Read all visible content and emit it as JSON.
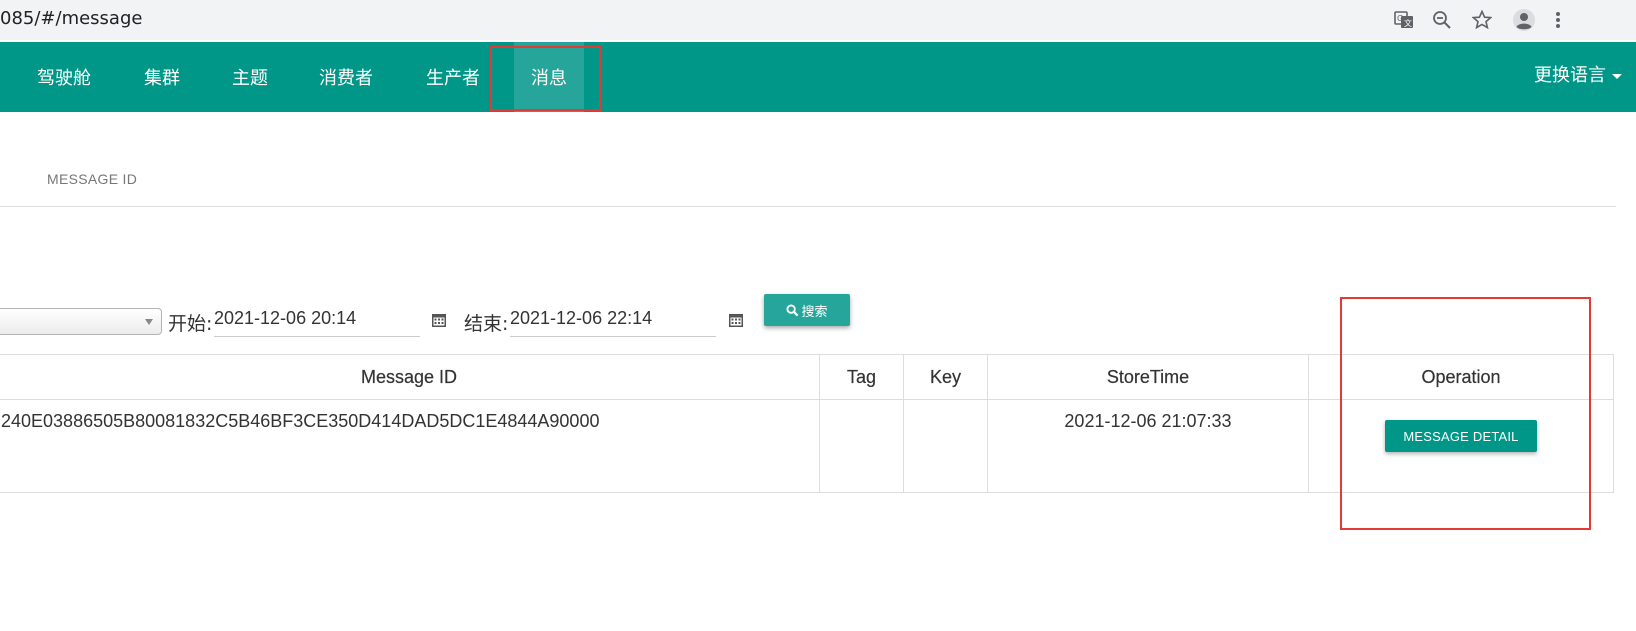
{
  "browser": {
    "url": "085/#/message",
    "icons": [
      "translate-icon",
      "zoom-out-icon",
      "bookmark-star-icon",
      "profile-icon",
      "kebab-menu-icon"
    ]
  },
  "nav": {
    "items": [
      {
        "label": "驾驶舱"
      },
      {
        "label": "集群"
      },
      {
        "label": "主题"
      },
      {
        "label": "消费者"
      },
      {
        "label": "生产者"
      },
      {
        "label": "消息",
        "active": true
      }
    ],
    "language_menu": "更换语言"
  },
  "tabs": {
    "active": "MESSAGE ID"
  },
  "search": {
    "start_label": "开始:",
    "start_value": "2021-12-06 20:14",
    "end_label": "结束:",
    "end_value": "2021-12-06 22:14",
    "button_label": "搜索"
  },
  "table": {
    "headers": [
      "Message ID",
      "Tag",
      "Key",
      "StoreTime",
      "Operation"
    ],
    "rows": [
      {
        "message_id": "240E03886505B80081832C5B46BF3CE350D414DAD5DC1E4844A90000",
        "tag": "",
        "key": "",
        "store_time": "2021-12-06 21:07:33",
        "operation": "MESSAGE DETAIL"
      }
    ]
  },
  "colors": {
    "primary": "#009688",
    "active_nav": "#26a69a",
    "highlight_box": "#e53935"
  }
}
